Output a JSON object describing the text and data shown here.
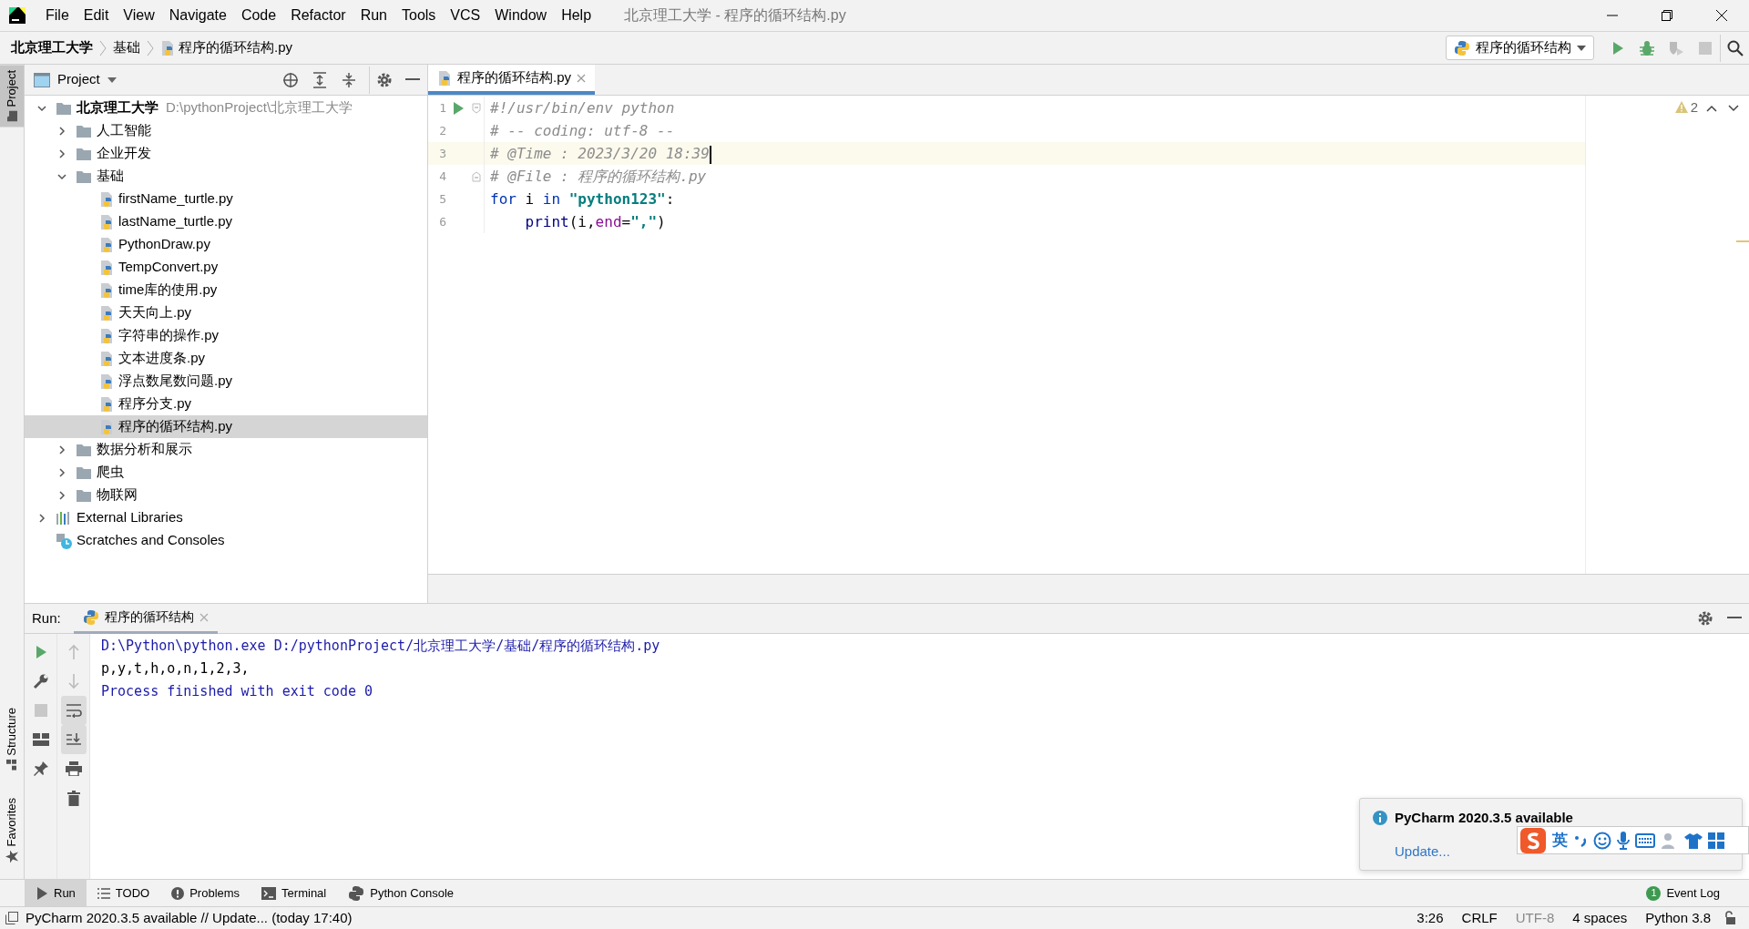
{
  "window": {
    "title": "北京理工大学 - 程序的循环结构.py"
  },
  "menu": [
    "File",
    "Edit",
    "View",
    "Navigate",
    "Code",
    "Refactor",
    "Run",
    "Tools",
    "VCS",
    "Window",
    "Help"
  ],
  "breadcrumbs": [
    {
      "label": "北京理工大学",
      "kind": "project"
    },
    {
      "label": "基础",
      "kind": "folder"
    },
    {
      "label": "程序的循环结构.py",
      "kind": "python"
    }
  ],
  "run_config": {
    "label": "程序的循环结构"
  },
  "side_stripe": [
    {
      "label": "Project",
      "selected": true
    },
    {
      "label": "Structure",
      "selected": false
    },
    {
      "label": "Favorites",
      "selected": false
    }
  ],
  "project_panel": {
    "title": "Project",
    "tree": [
      {
        "label": "北京理工大学",
        "path": "D:\\pythonProject\\北京理工大学",
        "kind": "root",
        "expanded": true,
        "selected": false,
        "children": [
          {
            "label": "人工智能",
            "kind": "folder",
            "expanded": false,
            "selected": false
          },
          {
            "label": "企业开发",
            "kind": "folder",
            "expanded": false,
            "selected": false
          },
          {
            "label": "基础",
            "kind": "folder",
            "expanded": true,
            "selected": false,
            "children": [
              {
                "label": "firstName_turtle.py",
                "kind": "python",
                "selected": false
              },
              {
                "label": "lastName_turtle.py",
                "kind": "python",
                "selected": false
              },
              {
                "label": "PythonDraw.py",
                "kind": "python",
                "selected": false
              },
              {
                "label": "TempConvert.py",
                "kind": "python",
                "selected": false
              },
              {
                "label": "time库的使用.py",
                "kind": "python",
                "selected": false
              },
              {
                "label": "天天向上.py",
                "kind": "python",
                "selected": false
              },
              {
                "label": "字符串的操作.py",
                "kind": "python",
                "selected": false
              },
              {
                "label": "文本进度条.py",
                "kind": "python",
                "selected": false
              },
              {
                "label": "浮点数尾数问题.py",
                "kind": "python",
                "selected": false
              },
              {
                "label": "程序分支.py",
                "kind": "python",
                "selected": false
              },
              {
                "label": "程序的循环结构.py",
                "kind": "python",
                "selected": true
              }
            ]
          },
          {
            "label": "数据分析和展示",
            "kind": "folder",
            "expanded": false,
            "selected": false
          },
          {
            "label": "爬虫",
            "kind": "folder",
            "expanded": false,
            "selected": false
          },
          {
            "label": "物联网",
            "kind": "folder",
            "expanded": false,
            "selected": false
          }
        ]
      },
      {
        "label": "External Libraries",
        "kind": "libraries",
        "expanded": false,
        "selected": false
      },
      {
        "label": "Scratches and Consoles",
        "kind": "scratches",
        "selected": false
      }
    ]
  },
  "editor": {
    "tab": {
      "label": "程序的循环结构.py",
      "selected": true
    },
    "warnings": "2",
    "lines": [
      {
        "number": "1",
        "run_marker": true,
        "fold_marker": true,
        "current": false,
        "tokens": [
          {
            "kind": "comment",
            "text": "#!/usr/bin/env python"
          }
        ]
      },
      {
        "number": "2",
        "run_marker": false,
        "fold_marker": false,
        "current": false,
        "tokens": [
          {
            "kind": "comment",
            "text": "# -- coding: utf-8 --"
          }
        ]
      },
      {
        "number": "3",
        "run_marker": false,
        "fold_marker": false,
        "current": true,
        "tokens": [
          {
            "kind": "comment",
            "text": "# @Time : 2023/3/20 18:39"
          }
        ]
      },
      {
        "number": "4",
        "run_marker": false,
        "fold_marker": true,
        "current": false,
        "tokens": [
          {
            "kind": "comment",
            "text": "# @File : 程序的循环结构.py"
          }
        ]
      },
      {
        "number": "5",
        "run_marker": false,
        "fold_marker": false,
        "current": false,
        "tokens": [
          {
            "kind": "keyword",
            "text": "for"
          },
          {
            "kind": "plain",
            "text": " i "
          },
          {
            "kind": "keyword",
            "text": "in"
          },
          {
            "kind": "string",
            "text": " \"python123\""
          },
          {
            "kind": "plain",
            "text": ":"
          }
        ]
      },
      {
        "number": "6",
        "run_marker": false,
        "fold_marker": false,
        "current": false,
        "tokens": [
          {
            "kind": "builtin",
            "text": "    print"
          },
          {
            "kind": "plain",
            "text": "(i,"
          },
          {
            "kind": "param",
            "text": "end"
          },
          {
            "kind": "plain",
            "text": "="
          },
          {
            "kind": "string",
            "text": "\",\""
          },
          {
            "kind": "plain",
            "text": ")"
          }
        ]
      }
    ]
  },
  "run_panel": {
    "label": "Run:",
    "tab": {
      "label": "程序的循环结构",
      "selected": true
    },
    "output": [
      {
        "kind": "command",
        "text": "D:\\Python\\python.exe D:/pythonProject/北京理工大学/基础/程序的循环结构.py"
      },
      {
        "kind": "stdout",
        "text": "p,y,t,h,o,n,1,2,3,"
      },
      {
        "kind": "info",
        "text": "Process finished with exit code 0"
      }
    ]
  },
  "tool_tabs": [
    {
      "label": "Run",
      "selected": true
    },
    {
      "label": "TODO",
      "selected": false
    },
    {
      "label": "Problems",
      "selected": false
    },
    {
      "label": "Terminal",
      "selected": false
    },
    {
      "label": "Python Console",
      "selected": false
    }
  ],
  "event_log": {
    "label": "Event Log",
    "count": "1"
  },
  "notification": {
    "title": "PyCharm 2020.3.5 available",
    "link": "Update..."
  },
  "ime_bar": {
    "mode": "英"
  },
  "status_bar": {
    "message": "PyCharm 2020.3.5 available // Update... (today 17:40)",
    "items": [
      {
        "text": "3:26",
        "dimmed": false
      },
      {
        "text": "CRLF",
        "dimmed": false
      },
      {
        "text": "UTF-8",
        "dimmed": true
      },
      {
        "text": "4 spaces",
        "dimmed": false
      },
      {
        "text": "Python 3.8",
        "dimmed": false
      }
    ]
  }
}
